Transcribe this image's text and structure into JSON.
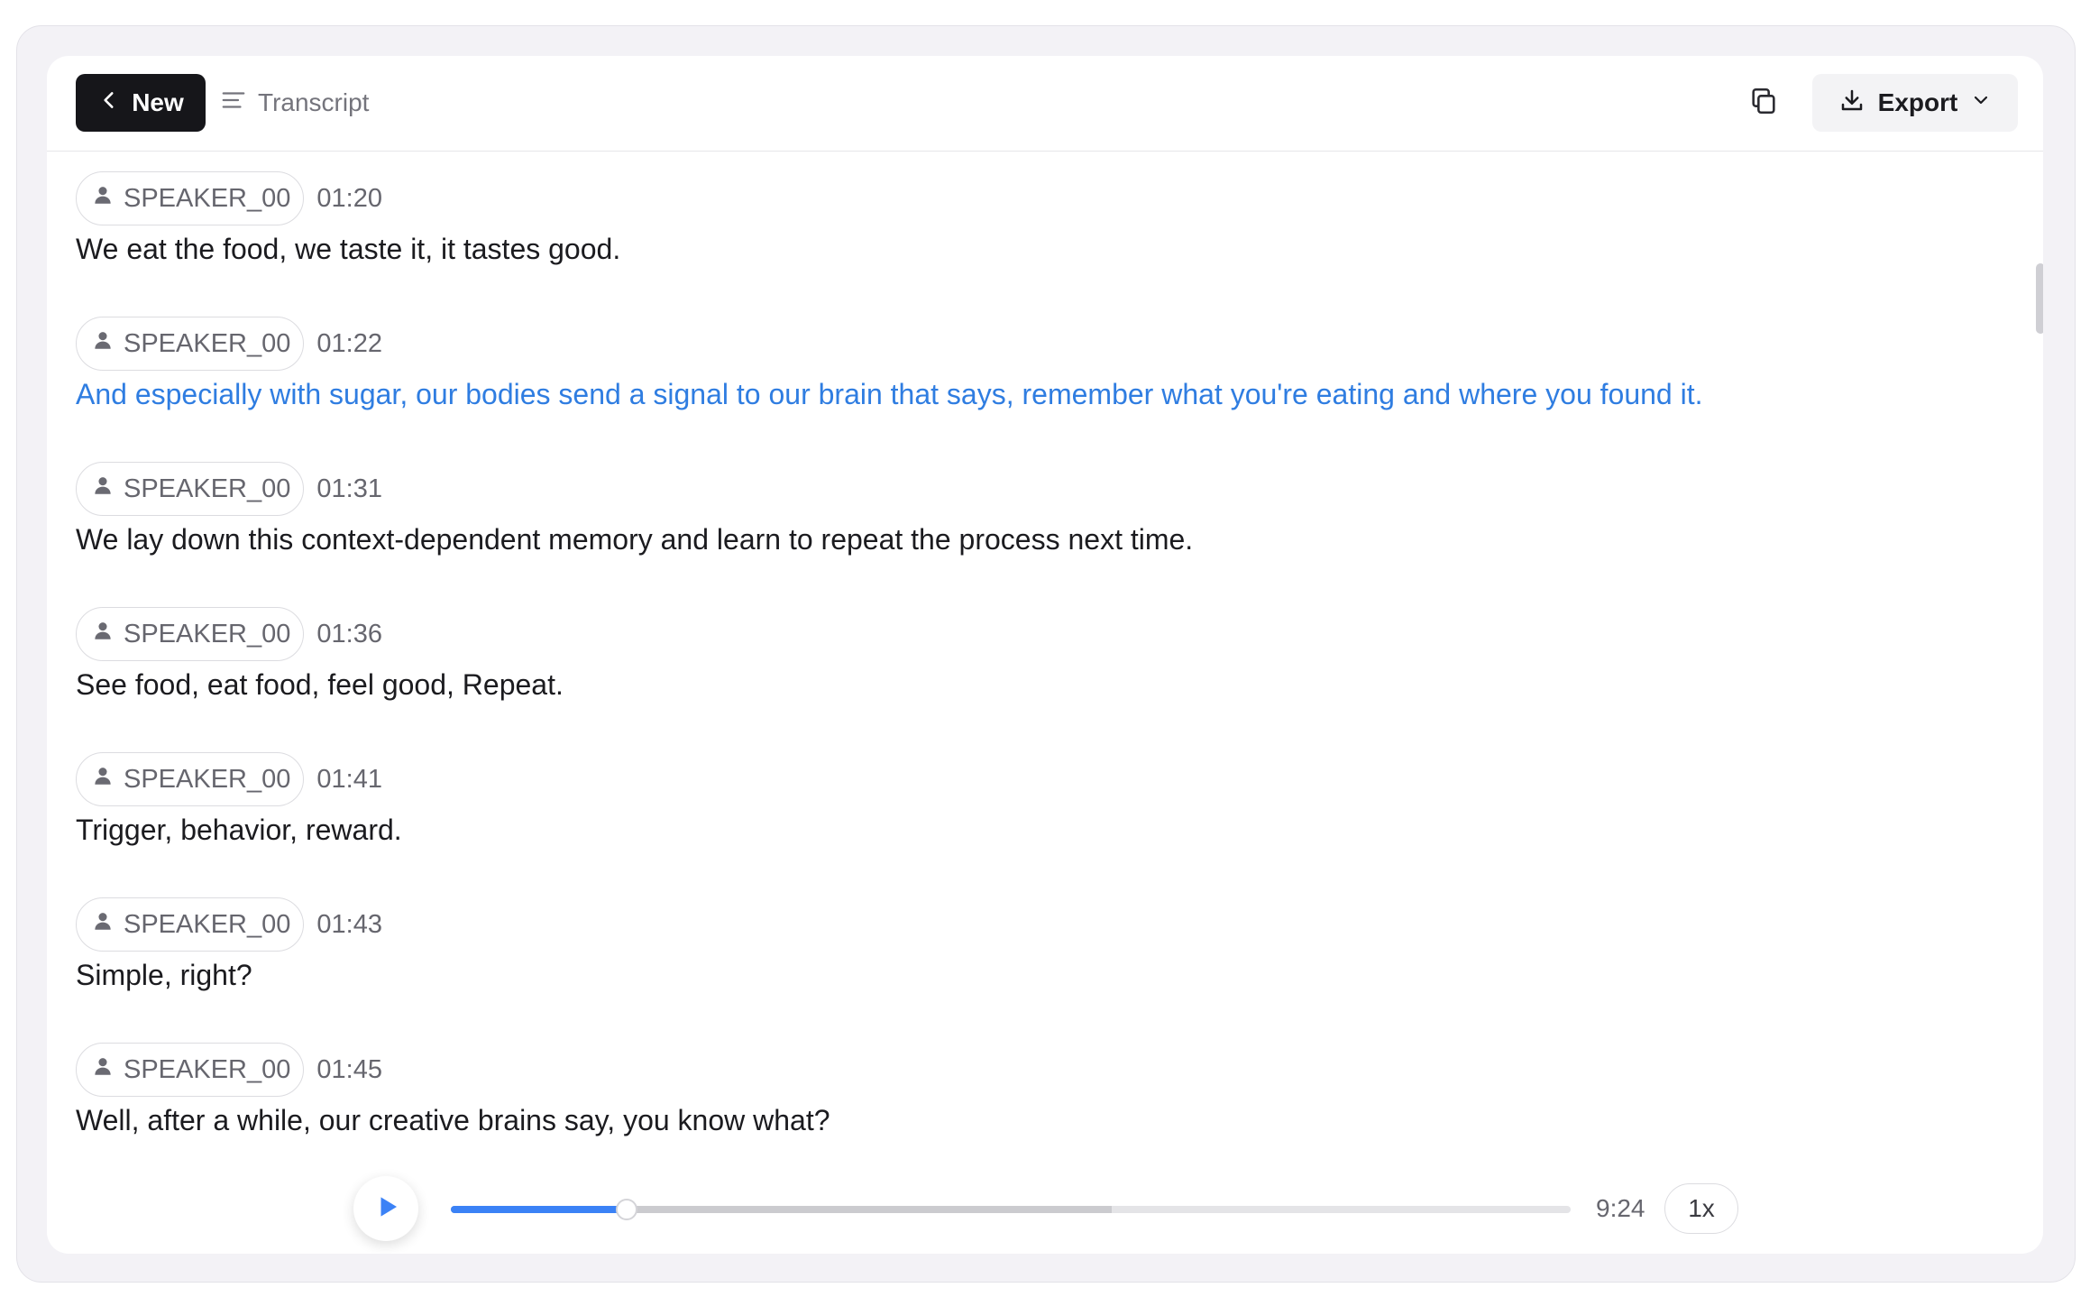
{
  "header": {
    "new_label": "New",
    "tab_label": "Transcript",
    "export_label": "Export"
  },
  "entries": [
    {
      "speaker": "SPEAKER_00",
      "time": "01:20",
      "text": "We eat the food, we taste it, it tastes good.",
      "active": false
    },
    {
      "speaker": "SPEAKER_00",
      "time": "01:22",
      "text": "And especially with sugar, our bodies send a signal to our brain that says, remember what you're eating and where you found it.",
      "active": true
    },
    {
      "speaker": "SPEAKER_00",
      "time": "01:31",
      "text": "We lay down this context-dependent memory and learn to repeat the process next time.",
      "active": false
    },
    {
      "speaker": "SPEAKER_00",
      "time": "01:36",
      "text": "See food, eat food, feel good, Repeat.",
      "active": false
    },
    {
      "speaker": "SPEAKER_00",
      "time": "01:41",
      "text": "Trigger, behavior, reward.",
      "active": false
    },
    {
      "speaker": "SPEAKER_00",
      "time": "01:43",
      "text": "Simple, right?",
      "active": false
    },
    {
      "speaker": "SPEAKER_00",
      "time": "01:45",
      "text": "Well, after a while, our creative brains say, you know what?",
      "active": false
    }
  ],
  "player": {
    "duration": "9:24",
    "speed": "1x",
    "progress_fraction": 0.157,
    "buffered_fraction": 0.59
  },
  "colors": {
    "accent": "#2f7de1",
    "progress": "#3b82f6",
    "new_button_bg": "#16161a"
  },
  "icons": {
    "new_button": "chevron-left-icon",
    "tab": "lines-icon",
    "copy": "copy-icon",
    "export": "download-icon",
    "export_menu": "chevron-down-icon",
    "speaker": "user-icon",
    "player": "play-icon"
  }
}
